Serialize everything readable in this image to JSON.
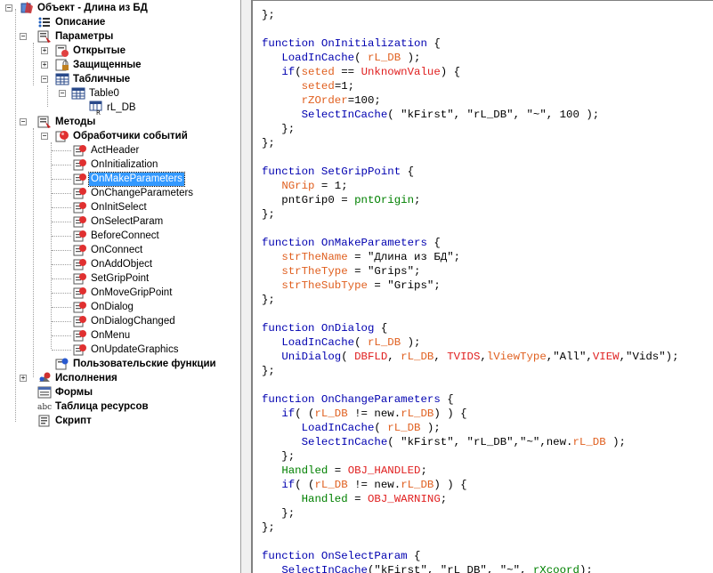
{
  "tree": {
    "root": "Объект - Длина из БД",
    "description": "Описание",
    "parameters": "Параметры",
    "open": "Открытые",
    "protected": "Защищенные",
    "tabular": "Табличные",
    "table0": "Table0",
    "rl_db": "rL_DB",
    "methods": "Методы",
    "event_handlers": "Обработчики событий",
    "handlers": [
      "ActHeader",
      "OnInitialization",
      "OnMakeParameters",
      "OnChangeParameters",
      "OnInitSelect",
      "OnSelectParam",
      "BeforeConnect",
      "OnConnect",
      "OnAddObject",
      "SetGripPoint",
      "OnMoveGripPoint",
      "OnDialog",
      "OnDialogChanged",
      "OnMenu",
      "OnUpdateGraphics"
    ],
    "selected_handler": "OnMakeParameters",
    "user_functions": "Пользовательские функции",
    "executions": "Исполнения",
    "forms": "Формы",
    "resources": "Таблица ресурсов",
    "script": "Скрипт"
  },
  "colors": {
    "keyword": "#0000b0",
    "identifier": "#e06020",
    "constant": "#e02020",
    "selection": "#3399ff"
  },
  "code_lines": [
    [
      [
        "};",
        "nm"
      ]
    ],
    [],
    [
      [
        "function ",
        "kw"
      ],
      [
        "OnInitialization",
        "fn"
      ],
      [
        " {",
        "nm"
      ]
    ],
    [
      [
        "   ",
        "nm"
      ],
      [
        "LoadInCache",
        "kw"
      ],
      [
        "( ",
        "nm"
      ],
      [
        "rL_DB",
        "id"
      ],
      [
        " );",
        "nm"
      ]
    ],
    [
      [
        "   ",
        "nm"
      ],
      [
        "if",
        "kw"
      ],
      [
        "(",
        "nm"
      ],
      [
        "seted",
        "id"
      ],
      [
        " == ",
        "nm"
      ],
      [
        "UnknownValue",
        "cv"
      ],
      [
        ") {",
        "nm"
      ]
    ],
    [
      [
        "      ",
        "nm"
      ],
      [
        "seted",
        "id"
      ],
      [
        "=1;",
        "nm"
      ]
    ],
    [
      [
        "      ",
        "nm"
      ],
      [
        "rZOrder",
        "id"
      ],
      [
        "=100;",
        "nm"
      ]
    ],
    [
      [
        "      ",
        "nm"
      ],
      [
        "SelectInCache",
        "kw"
      ],
      [
        "( \"kFirst\", \"rL_DB\", \"~\", 100 );",
        "nm"
      ]
    ],
    [
      [
        "   };",
        "nm"
      ]
    ],
    [
      [
        "};",
        "nm"
      ]
    ],
    [],
    [
      [
        "function ",
        "kw"
      ],
      [
        "SetGripPoint",
        "fn"
      ],
      [
        " {",
        "nm"
      ]
    ],
    [
      [
        "   ",
        "nm"
      ],
      [
        "NGrip",
        "id"
      ],
      [
        " = 1;",
        "nm"
      ]
    ],
    [
      [
        "   pntGrip0 = ",
        "nm"
      ],
      [
        "pntOrigin",
        "gr"
      ],
      [
        ";",
        "nm"
      ]
    ],
    [
      [
        "};",
        "nm"
      ]
    ],
    [],
    [
      [
        "function ",
        "kw"
      ],
      [
        "OnMakeParameters",
        "fn"
      ],
      [
        " {",
        "nm"
      ]
    ],
    [
      [
        "   ",
        "nm"
      ],
      [
        "strTheName",
        "id"
      ],
      [
        " = \"Длина из БД\";",
        "nm"
      ]
    ],
    [
      [
        "   ",
        "nm"
      ],
      [
        "strTheType",
        "id"
      ],
      [
        " = \"Grips\";",
        "nm"
      ]
    ],
    [
      [
        "   ",
        "nm"
      ],
      [
        "strTheSubType",
        "id"
      ],
      [
        " = \"Grips\";",
        "nm"
      ]
    ],
    [
      [
        "};",
        "nm"
      ]
    ],
    [],
    [
      [
        "function ",
        "kw"
      ],
      [
        "OnDialog",
        "fn"
      ],
      [
        " {",
        "nm"
      ]
    ],
    [
      [
        "   ",
        "nm"
      ],
      [
        "LoadInCache",
        "kw"
      ],
      [
        "( ",
        "nm"
      ],
      [
        "rL_DB",
        "id"
      ],
      [
        " );",
        "nm"
      ]
    ],
    [
      [
        "   ",
        "nm"
      ],
      [
        "UniDialog",
        "kw"
      ],
      [
        "( ",
        "nm"
      ],
      [
        "DBFLD",
        "cv"
      ],
      [
        ", ",
        "nm"
      ],
      [
        "rL_DB",
        "id"
      ],
      [
        ", ",
        "nm"
      ],
      [
        "TVIDS",
        "cv"
      ],
      [
        ",",
        "nm"
      ],
      [
        "lViewType",
        "id"
      ],
      [
        ",\"All\",",
        "nm"
      ],
      [
        "VIEW",
        "cv"
      ],
      [
        ",\"Vids\");",
        "nm"
      ]
    ],
    [
      [
        "};",
        "nm"
      ]
    ],
    [],
    [
      [
        "function ",
        "kw"
      ],
      [
        "OnChangeParameters",
        "fn"
      ],
      [
        " {",
        "nm"
      ]
    ],
    [
      [
        "   ",
        "nm"
      ],
      [
        "if",
        "kw"
      ],
      [
        "( (",
        "nm"
      ],
      [
        "rL_DB",
        "id"
      ],
      [
        " != new.",
        "nm"
      ],
      [
        "rL_DB",
        "id"
      ],
      [
        ") ) {",
        "nm"
      ]
    ],
    [
      [
        "      ",
        "nm"
      ],
      [
        "LoadInCache",
        "kw"
      ],
      [
        "( ",
        "nm"
      ],
      [
        "rL_DB",
        "id"
      ],
      [
        " );",
        "nm"
      ]
    ],
    [
      [
        "      ",
        "nm"
      ],
      [
        "SelectInCache",
        "kw"
      ],
      [
        "( \"kFirst\", \"rL_DB\",\"~\",new.",
        "nm"
      ],
      [
        "rL_DB",
        "id"
      ],
      [
        " );",
        "nm"
      ]
    ],
    [
      [
        "   };",
        "nm"
      ]
    ],
    [
      [
        "   ",
        "nm"
      ],
      [
        "Handled",
        "gr"
      ],
      [
        " = ",
        "nm"
      ],
      [
        "OBJ_HANDLED",
        "cv"
      ],
      [
        ";",
        "nm"
      ]
    ],
    [
      [
        "   ",
        "nm"
      ],
      [
        "if",
        "kw"
      ],
      [
        "( (",
        "nm"
      ],
      [
        "rL_DB",
        "id"
      ],
      [
        " != new.",
        "nm"
      ],
      [
        "rL_DB",
        "id"
      ],
      [
        ") ) {",
        "nm"
      ]
    ],
    [
      [
        "      ",
        "nm"
      ],
      [
        "Handled",
        "gr"
      ],
      [
        " = ",
        "nm"
      ],
      [
        "OBJ_WARNING",
        "cv"
      ],
      [
        ";",
        "nm"
      ]
    ],
    [
      [
        "   };",
        "nm"
      ]
    ],
    [
      [
        "};",
        "nm"
      ]
    ],
    [],
    [
      [
        "function ",
        "kw"
      ],
      [
        "OnSelectParam",
        "fn"
      ],
      [
        " {",
        "nm"
      ]
    ],
    [
      [
        "   ",
        "nm"
      ],
      [
        "SelectInCache",
        "kw"
      ],
      [
        "(\"kFirst\", \"rL_DB\", \"~\", ",
        "nm"
      ],
      [
        "rXcoord",
        "gr"
      ],
      [
        ");",
        "nm"
      ]
    ]
  ]
}
